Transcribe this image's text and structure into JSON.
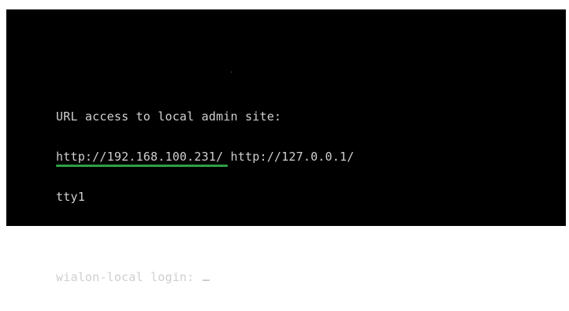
{
  "console": {
    "line1": "URL access to local admin site:",
    "url_primary": "http://192.168.100.231/",
    "url_secondary": " http://127.0.0.1/",
    "tty": "tty1",
    "login_prompt": "wialon-local login: "
  },
  "colors": {
    "background": "#000000",
    "text": "#cfcfcf",
    "highlight_underline": "#2ea043"
  }
}
